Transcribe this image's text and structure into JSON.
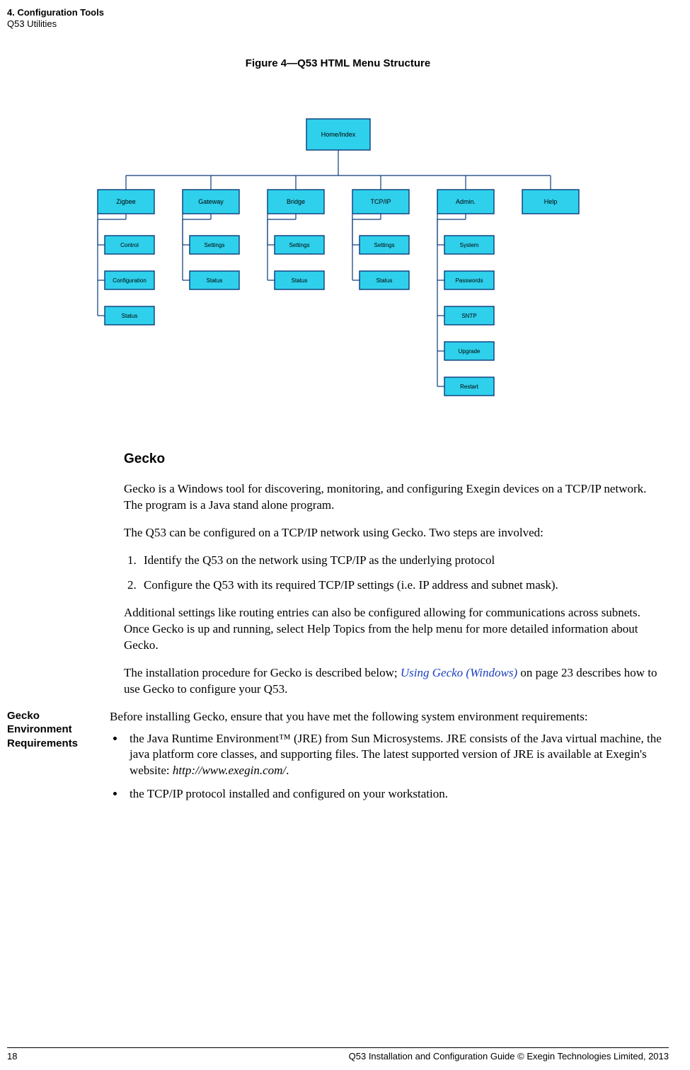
{
  "header": {
    "line1": "4. Configuration Tools",
    "line2": "Q53 Utilities"
  },
  "figure": {
    "title": "Figure 4—Q53 HTML Menu Structure"
  },
  "chart_data": {
    "type": "diagram",
    "root": "Home/Index",
    "branches": [
      {
        "name": "Zigbee",
        "children": [
          "Control",
          "Configuration",
          "Status"
        ]
      },
      {
        "name": "Gateway",
        "children": [
          "Settings",
          "Status"
        ]
      },
      {
        "name": "Bridge",
        "children": [
          "Settings",
          "Status"
        ]
      },
      {
        "name": "TCP/IP",
        "children": [
          "Settings",
          "Status"
        ]
      },
      {
        "name": "Admin.",
        "children": [
          "System",
          "Passwords",
          "SNTP",
          "Upgrade",
          "Restart"
        ]
      },
      {
        "name": "Help",
        "children": []
      }
    ],
    "node_fill": "#2fd0eb",
    "node_stroke": "#0a3b7a"
  },
  "sections": {
    "gecko_heading": "Gecko",
    "para1": "Gecko is a Windows tool for discovering, monitoring, and configuring Exegin devices on a TCP/IP network. The program is a Java stand alone program.",
    "para2": "The Q53 can be configured on a TCP/IP network using Gecko. Two steps are involved:",
    "ol": [
      "Identify the Q53 on the network using TCP/IP as the underlying protocol",
      "Configure the Q53 with its required TCP/IP settings (i.e. IP address and subnet mask)."
    ],
    "para3": "Additional settings like routing entries can also be configured allowing for communications across subnets. Once Gecko is up and running, select Help Topics from the help menu for more detailed information about Gecko.",
    "para4_pre": "The installation procedure for Gecko is described below; ",
    "para4_link": "Using Gecko (Windows)",
    "para4_post": " on page 23 describes how to use Gecko to configure your Q53."
  },
  "env": {
    "side": "Gecko Environment Requirements",
    "intro": "Before installing Gecko, ensure that you have met the following system environment requirements:",
    "bullets": [
      "the Java Runtime Environment™ (JRE) from Sun Microsystems. JRE consists of the Java virtual machine, the java platform core classes, and supporting files. The latest supported version of JRE is available at Exegin's website: http://www.exegin.com/.",
      "the TCP/IP protocol installed and configured on your workstation."
    ],
    "website": "http://www.exegin.com/"
  },
  "footer": {
    "page": "18",
    "right": "Q53 Installation and Configuration Guide  © Exegin Technologies Limited, 2013"
  }
}
